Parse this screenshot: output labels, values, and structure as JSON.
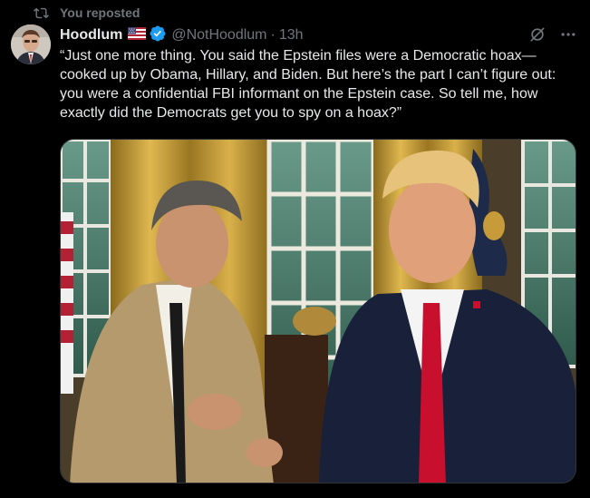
{
  "repost": {
    "label": "You reposted",
    "icon": "repost-icon"
  },
  "author": {
    "display_name": "Hoodlum",
    "flag_icon": "us-flag-icon",
    "verified_icon": "verified-badge-icon",
    "verified_color": "#1d9bf0",
    "handle": "@NotHoodlum",
    "separator": "·",
    "time": "13h"
  },
  "actions": {
    "grok_icon": "grok-icon",
    "more_icon": "more-options-icon"
  },
  "post": {
    "text": "“Just one more thing. You said the Epstein files were a Democratic hoax—cooked up by Obama, Hillary, and Biden. But here’s the part I can’t figure out: you were a confidential FBI informant on the Epstein case. So tell me, how exactly did the Democrats get you to spy on a hoax?”"
  },
  "media": {
    "kind": "image",
    "subject": "photo-illustration"
  },
  "colors": {
    "background": "#000000",
    "text_primary": "#e7e9ea",
    "text_secondary": "#71767b",
    "accent": "#1d9bf0"
  }
}
